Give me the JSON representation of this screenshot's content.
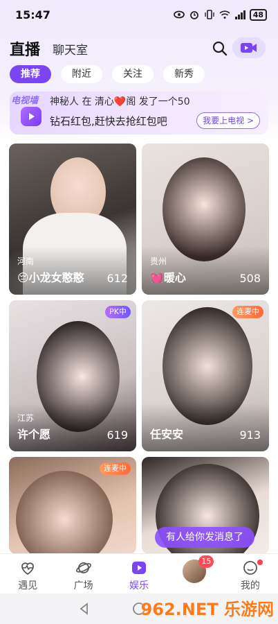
{
  "status_bar": {
    "time": "15:47",
    "battery": "48"
  },
  "header": {
    "title": "直播",
    "subtitle": "聊天室"
  },
  "tabs": [
    {
      "label": "推荐",
      "active": true
    },
    {
      "label": "附近",
      "active": false
    },
    {
      "label": "关注",
      "active": false
    },
    {
      "label": "新秀",
      "active": false
    }
  ],
  "banner": {
    "label": "电视墙",
    "ticker": "神秘人 在 清心❤️阁 发了一个50",
    "message": "钻石红包,赶快去抢红包吧",
    "button": "我要上电视 >"
  },
  "cards": [
    {
      "location": "河南",
      "name": "😔小龙女憨憨",
      "count": "612",
      "badge": ""
    },
    {
      "location": "贵州",
      "name": "💓暖心",
      "count": "508",
      "badge": ""
    },
    {
      "location": "江苏",
      "name": "许个愿",
      "count": "619",
      "badge": "PK中"
    },
    {
      "location": "",
      "name": "任安安",
      "count": "913",
      "badge": "连麦中"
    },
    {
      "location": "",
      "name": "",
      "count": "",
      "badge": "连麦中"
    },
    {
      "location": "",
      "name": "",
      "count": "",
      "badge": ""
    }
  ],
  "toast": "有人给你发消息了",
  "tabbar": {
    "items": [
      {
        "label": "遇见",
        "icon": "heart-pulse-icon"
      },
      {
        "label": "广场",
        "icon": "planet-icon"
      },
      {
        "label": "娱乐",
        "icon": "play-icon"
      },
      {
        "label": "",
        "icon": "avatar"
      },
      {
        "label": "我的",
        "icon": "smile-icon"
      }
    ],
    "message_count": "15"
  },
  "watermark": "962.NET 乐游网"
}
